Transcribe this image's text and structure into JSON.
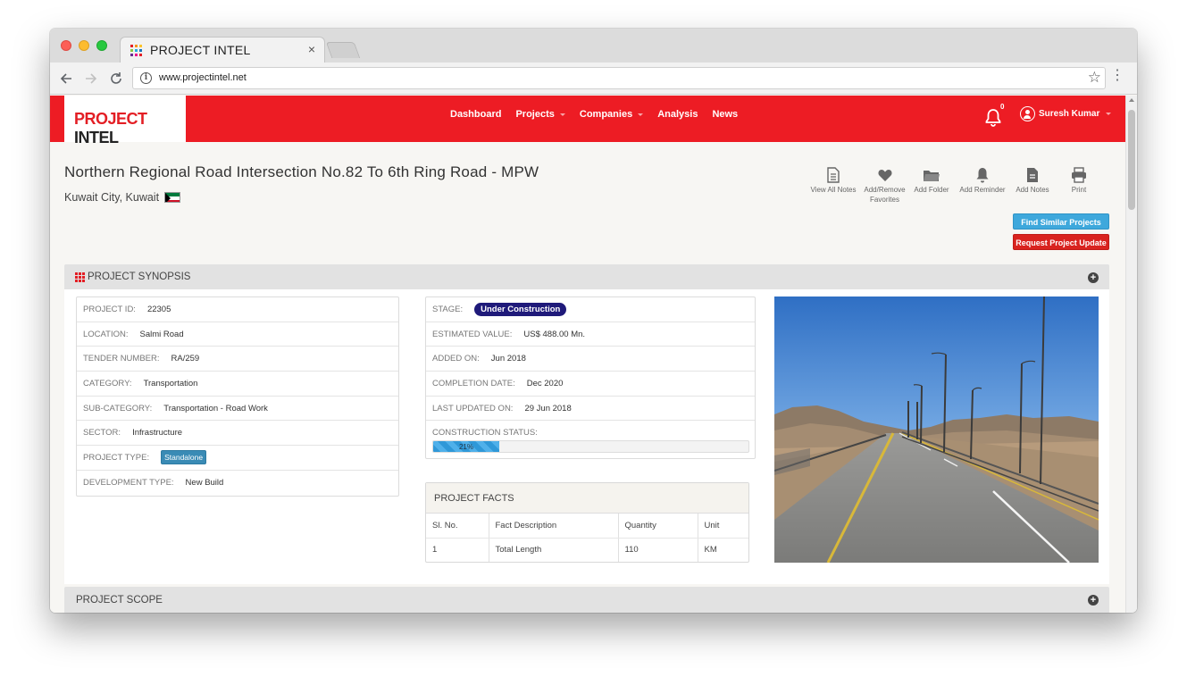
{
  "browser": {
    "tab_title": "PROJECT INTEL",
    "tab_close": "×",
    "url": "www.projectintel.net",
    "colors": {
      "favicon": [
        "#e31e24",
        "#f7941d",
        "#fcc42b",
        "#8cc63f",
        "#27aae1",
        "#1c75bc",
        "#662d91",
        "#ec008c",
        "#e31e24"
      ]
    }
  },
  "header": {
    "logo_part1": "PROJECT",
    "logo_part2": "INTEL",
    "nav": [
      {
        "label": "Dashboard",
        "has_caret": false
      },
      {
        "label": "Projects",
        "has_caret": true
      },
      {
        "label": "Companies",
        "has_caret": true
      },
      {
        "label": "Analysis",
        "has_caret": false
      },
      {
        "label": "News",
        "has_caret": false
      }
    ],
    "notification_count": "0",
    "user_name": "Suresh Kumar",
    "accent_color": "#ed1c24"
  },
  "project": {
    "title": "Northern Regional Road Intersection No.82 To 6th Ring Road - MPW",
    "location": "Kuwait City, Kuwait"
  },
  "actions": [
    {
      "label": "View All Notes",
      "icon": "document-icon"
    },
    {
      "label": "Add/Remove Favorites",
      "icon": "heart-icon"
    },
    {
      "label": "Add Folder",
      "icon": "folder-icon"
    },
    {
      "label": "Add Reminder",
      "icon": "bell-icon"
    },
    {
      "label": "Add Notes",
      "icon": "note-icon"
    },
    {
      "label": "Print",
      "icon": "printer-icon"
    }
  ],
  "buttons": {
    "find_similar": "Find Similar Projects",
    "request_update": "Request Project Update"
  },
  "synopsis": {
    "title": "PROJECT SYNOPSIS",
    "left": [
      {
        "key": "PROJECT ID:",
        "value": "22305"
      },
      {
        "key": "LOCATION:",
        "value": "Salmi Road"
      },
      {
        "key": "TENDER NUMBER:",
        "value": "RA/259"
      },
      {
        "key": "CATEGORY:",
        "value": "Transportation"
      },
      {
        "key": "SUB-CATEGORY:",
        "value": "Transportation - Road Work"
      },
      {
        "key": "SECTOR:",
        "value": "Infrastructure"
      },
      {
        "key": "PROJECT TYPE:",
        "value": "Standalone"
      },
      {
        "key": "DEVELOPMENT TYPE:",
        "value": "New Build"
      }
    ],
    "middle": [
      {
        "key": "STAGE:",
        "value": "Under Construction"
      },
      {
        "key": "ESTIMATED VALUE:",
        "value": "US$ 488.00 Mn."
      },
      {
        "key": "ADDED ON:",
        "value": "Jun 2018"
      },
      {
        "key": "COMPLETION DATE:",
        "value": "Dec 2020"
      },
      {
        "key": "LAST UPDATED ON:",
        "value": "29 Jun 2018"
      }
    ],
    "construction_status_label": "CONSTRUCTION STATUS:",
    "construction_status_text": "21%",
    "construction_status_value": 21
  },
  "facts": {
    "title": "PROJECT FACTS",
    "columns": [
      "Sl. No.",
      "Fact Description",
      "Quantity",
      "Unit"
    ],
    "rows": [
      [
        "1",
        "Total Length",
        "110",
        "KM"
      ]
    ]
  },
  "scope": {
    "title": "PROJECT SCOPE"
  }
}
